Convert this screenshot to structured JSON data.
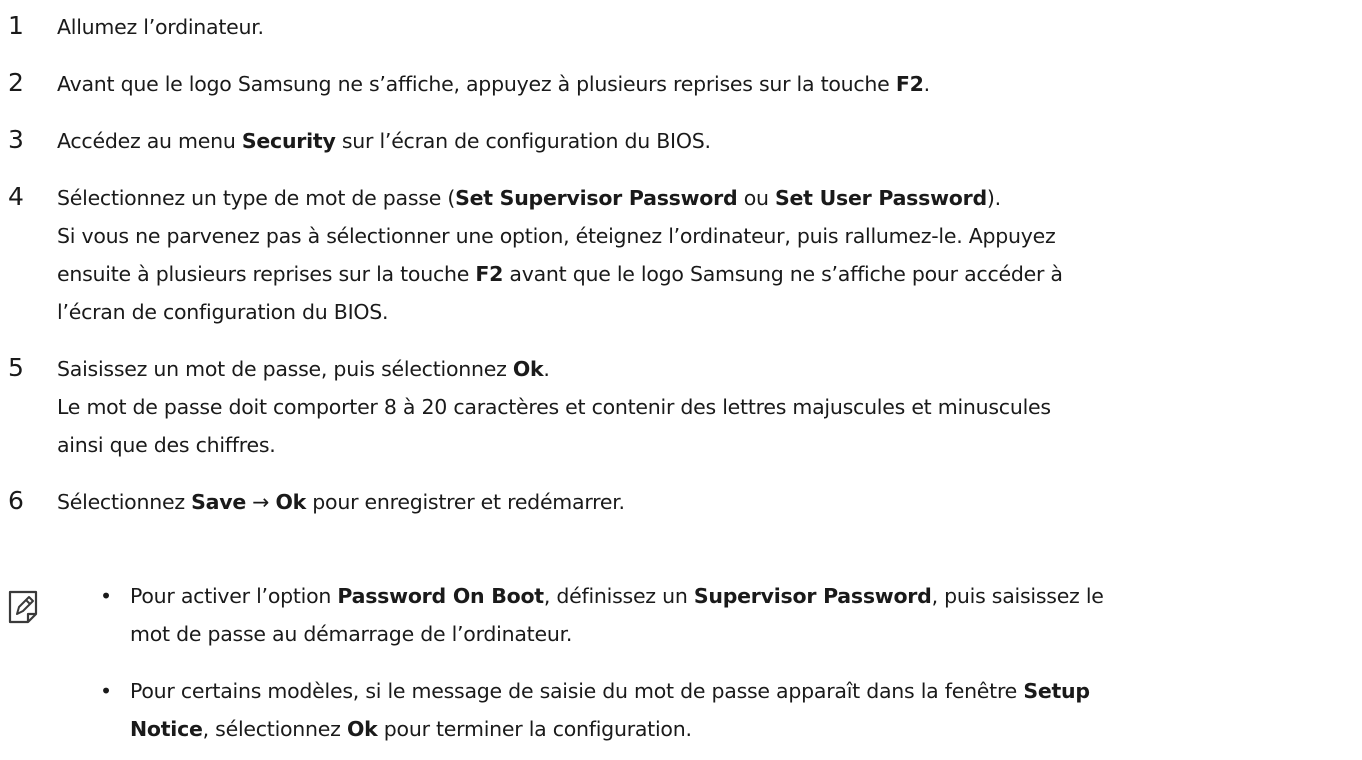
{
  "steps": [
    {
      "number": "1",
      "lines": [
        [
          {
            "t": "Allumez l’ordinateur."
          }
        ]
      ]
    },
    {
      "number": "2",
      "lines": [
        [
          {
            "t": "Avant que le logo Samsung ne s’affiche, appuyez à plusieurs reprises sur la touche "
          },
          {
            "t": "F2",
            "b": true
          },
          {
            "t": "."
          }
        ]
      ]
    },
    {
      "number": "3",
      "lines": [
        [
          {
            "t": "Accédez au menu "
          },
          {
            "t": "Security",
            "b": true
          },
          {
            "t": " sur l’écran de configuration du BIOS."
          }
        ]
      ]
    },
    {
      "number": "4",
      "lines": [
        [
          {
            "t": "Sélectionnez un type de mot de passe ("
          },
          {
            "t": "Set Supervisor Password",
            "b": true
          },
          {
            "t": " ou "
          },
          {
            "t": "Set User Password",
            "b": true
          },
          {
            "t": ")."
          }
        ],
        [
          {
            "t": "Si vous ne parvenez pas à sélectionner une option, éteignez l’ordinateur, puis rallumez-le. Appuyez"
          }
        ],
        [
          {
            "t": "ensuite à plusieurs reprises sur la touche "
          },
          {
            "t": "F2",
            "b": true
          },
          {
            "t": " avant que le logo Samsung ne s’affiche pour accéder à"
          }
        ],
        [
          {
            "t": "l’écran de configuration du BIOS."
          }
        ]
      ]
    },
    {
      "number": "5",
      "lines": [
        [
          {
            "t": "Saisissez un mot de passe, puis sélectionnez "
          },
          {
            "t": "Ok",
            "b": true
          },
          {
            "t": "."
          }
        ],
        [
          {
            "t": "Le mot de passe doit comporter 8 à 20 caractères et contenir des lettres majuscules et minuscules"
          }
        ],
        [
          {
            "t": "ainsi que des chiffres."
          }
        ]
      ]
    },
    {
      "number": "6",
      "lines": [
        [
          {
            "t": "Sélectionnez "
          },
          {
            "t": "Save",
            "b": true
          },
          {
            "t": " → "
          },
          {
            "t": "Ok",
            "b": true
          },
          {
            "t": " pour enregistrer et redémarrer."
          }
        ]
      ]
    }
  ],
  "note": {
    "icon": "note-icon",
    "bullet_glyph": "•",
    "bullets": [
      [
        [
          {
            "t": "Pour activer l’option "
          },
          {
            "t": "Password On Boot",
            "b": true
          },
          {
            "t": ", définissez un "
          },
          {
            "t": "Supervisor Password",
            "b": true
          },
          {
            "t": ", puis saisissez le"
          }
        ],
        [
          {
            "t": "mot de passe au démarrage de l’ordinateur."
          }
        ]
      ],
      [
        [
          {
            "t": "Pour certains modèles, si le message de saisie du mot de passe apparaît dans la fenêtre "
          },
          {
            "t": "Setup",
            "b": true
          }
        ],
        [
          {
            "t": "Notice",
            "b": true
          },
          {
            "t": ", sélectionnez "
          },
          {
            "t": "Ok",
            "b": true
          },
          {
            "t": " pour terminer la configuration."
          }
        ]
      ]
    ]
  },
  "colors": {
    "text": "#1a1a1a",
    "background": "#ffffff",
    "icon_stroke": "#3a3a3a"
  }
}
